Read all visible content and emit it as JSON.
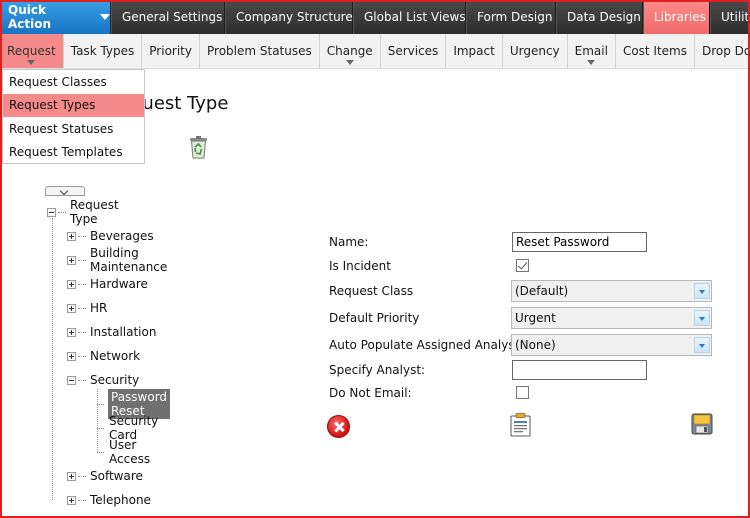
{
  "topnav": {
    "quick_action": "Quick Action",
    "items": [
      "General Settings",
      "Company Structure",
      "Global List Views",
      "Form Design",
      "Data Design",
      "Libraries",
      "Utiliti"
    ],
    "active_index": 5
  },
  "subnav": {
    "items": [
      "Request",
      "Task Types",
      "Priority",
      "Problem Statuses",
      "Change",
      "Services",
      "Impact",
      "Urgency",
      "Email",
      "Cost Items",
      "Drop Down"
    ],
    "active_index": 0
  },
  "dropdown": {
    "options": [
      "Request Classes",
      "Request Types",
      "Request Statuses",
      "Request Templates"
    ],
    "selected_index": 1
  },
  "page": {
    "title": "quest Type"
  },
  "tree": {
    "root": "Request Type",
    "children": [
      "Beverages",
      "Building Maintenance",
      "Hardware",
      "HR",
      "Installation",
      "Network",
      "Security",
      "Software",
      "Telephone"
    ],
    "security_children": [
      "Password Reset",
      "Security Card",
      "User Access"
    ],
    "selected": "Password Reset"
  },
  "form": {
    "name_label": "Name:",
    "name_value": "Reset Password",
    "is_incident_label": "Is Incident",
    "is_incident_checked": true,
    "request_class_label": "Request Class",
    "request_class_value": "(Default)",
    "default_priority_label": "Default Priority",
    "default_priority_value": "Urgent",
    "auto_populate_label": "Auto Populate Assigned Analyst:",
    "auto_populate_value": "(None)",
    "specify_analyst_label": "Specify Analyst:",
    "specify_analyst_value": "",
    "do_not_email_label": "Do Not Email:",
    "do_not_email_checked": false
  },
  "colors": {
    "accent_blue": "#1874c4",
    "active_pink": "#f48a8a",
    "frame_red": "#e0201c"
  },
  "icons": [
    "chevron-down-icon",
    "recycle-bin-icon",
    "cancel-icon",
    "clipboard-icon",
    "save-icon"
  ]
}
